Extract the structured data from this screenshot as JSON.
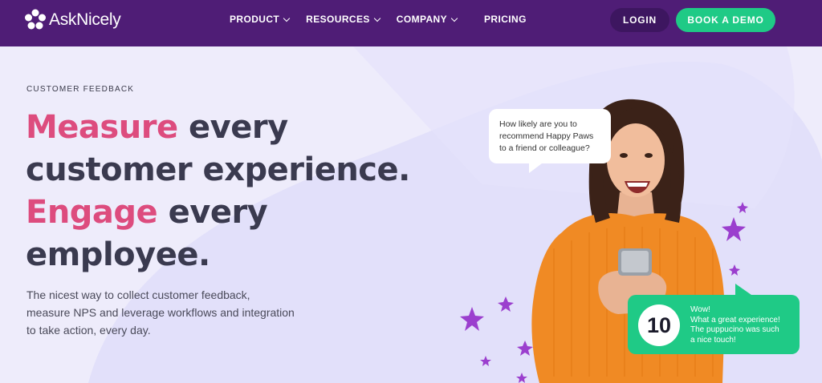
{
  "brand": {
    "name": "AskNicely"
  },
  "nav": {
    "items": [
      {
        "label": "PRODUCT",
        "dropdown": true
      },
      {
        "label": "RESOURCES",
        "dropdown": true
      },
      {
        "label": "COMPANY",
        "dropdown": true
      },
      {
        "label": "PRICING",
        "dropdown": false
      }
    ],
    "login_label": "LOGIN",
    "demo_label": "BOOK A DEMO"
  },
  "hero": {
    "eyebrow": "CUSTOMER FEEDBACK",
    "headline": {
      "measure": "Measure",
      "every1": " every",
      "line2": "customer experience.",
      "engage": "Engage",
      "every2": " every",
      "line4": "employee."
    },
    "line_a": "The nicest way to collect customer feedback,",
    "line_b": "measure NPS and leverage workflows and integration",
    "line_c": "to take action, every day."
  },
  "survey": {
    "q1": "How likely are you to",
    "q2": "recommend Happy Paws",
    "q3": "to a friend or colleague?",
    "score": "10",
    "a1": "Wow!",
    "a2": "What a great experience!",
    "a3": "The puppucino was such",
    "a4": "a nice touch!"
  },
  "colors": {
    "nav_bg": "#4f1d76",
    "accent_green": "#1fca86",
    "accent_pink": "#dd4c7e",
    "hero_bg": "#eeecfb",
    "star_purple": "#9b3fce",
    "sweater_orange": "#f08a24"
  }
}
